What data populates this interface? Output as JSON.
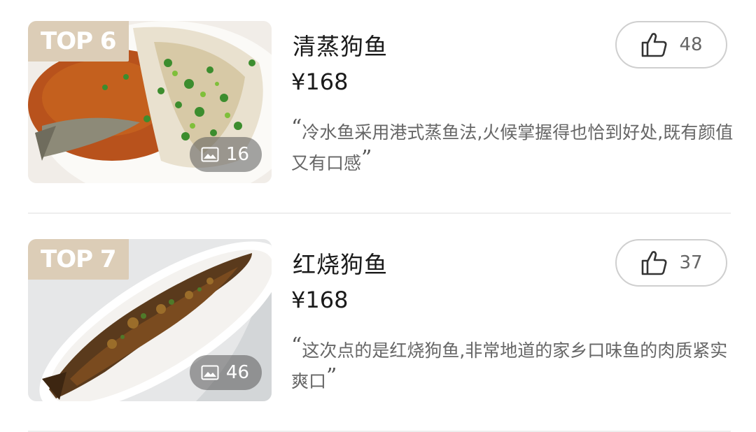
{
  "dishes": [
    {
      "rank": "TOP 6",
      "name": "清蒸狗鱼",
      "price": "¥168",
      "review": "冷水鱼采用港式蒸鱼法,火候掌握得也恰到好处,既有颜值又有口感",
      "quote_open": "“",
      "quote_close": "”",
      "photo_count": "16",
      "likes": "48"
    },
    {
      "rank": "TOP 7",
      "name": "红烧狗鱼",
      "price": "¥168",
      "review": "这次点的是红烧狗鱼,非常地道的家乡口味鱼的肉质紧实爽口",
      "quote_open": "“",
      "quote_close": "”",
      "photo_count": "46",
      "likes": "37"
    }
  ],
  "icons": {
    "like": "thumbs-up-icon",
    "photos": "image-icon"
  },
  "colors": {
    "badge_bg": "#dccdb7",
    "review_text": "#666666",
    "border": "#cfcfcf"
  }
}
